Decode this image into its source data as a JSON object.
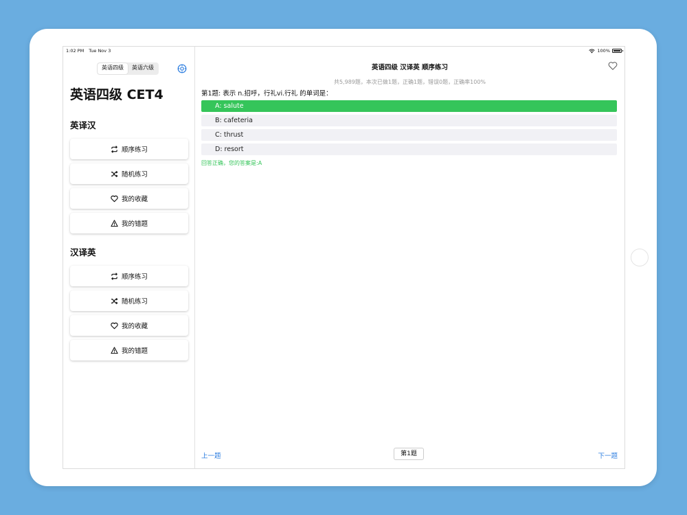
{
  "status_bar": {
    "time": "1:02 PM",
    "date": "Tue Nov 3",
    "battery": "100%"
  },
  "sidebar": {
    "segments": [
      {
        "label": "英语四级",
        "active": true
      },
      {
        "label": "英语六级",
        "active": false
      }
    ],
    "title": "英语四级 CET4",
    "sections": [
      {
        "title": "英译汉",
        "items": [
          {
            "label": "顺序练习",
            "icon": "repeat-icon"
          },
          {
            "label": "随机练习",
            "icon": "shuffle-icon"
          },
          {
            "label": "我的收藏",
            "icon": "heart-icon"
          },
          {
            "label": "我的错题",
            "icon": "warning-icon"
          }
        ]
      },
      {
        "title": "汉译英",
        "items": [
          {
            "label": "顺序练习",
            "icon": "repeat-icon"
          },
          {
            "label": "随机练习",
            "icon": "shuffle-icon"
          },
          {
            "label": "我的收藏",
            "icon": "heart-icon"
          },
          {
            "label": "我的错题",
            "icon": "warning-icon"
          }
        ]
      }
    ]
  },
  "main": {
    "nav_title": "英语四级 汉译英 顺序练习",
    "stats": "共5,989题，本次已做1题，正确1题，错误0题，正确率100%",
    "question": "第1题: 表示 n.招呼，行礼vi.行礼 的单词是：",
    "options": [
      {
        "label": "A: salute",
        "correct": true
      },
      {
        "label": "B: cafeteria",
        "correct": false
      },
      {
        "label": "C: thrust",
        "correct": false
      },
      {
        "label": "D: resort",
        "correct": false
      }
    ],
    "feedback": "回答正确，您的答案是:A",
    "prev_label": "上一题",
    "page_label": "第1题",
    "next_label": "下一题"
  },
  "colors": {
    "background": "#6aade0",
    "correct": "#35c55a",
    "link": "#2f7fe0",
    "stats_text": "#9a9a9a"
  }
}
